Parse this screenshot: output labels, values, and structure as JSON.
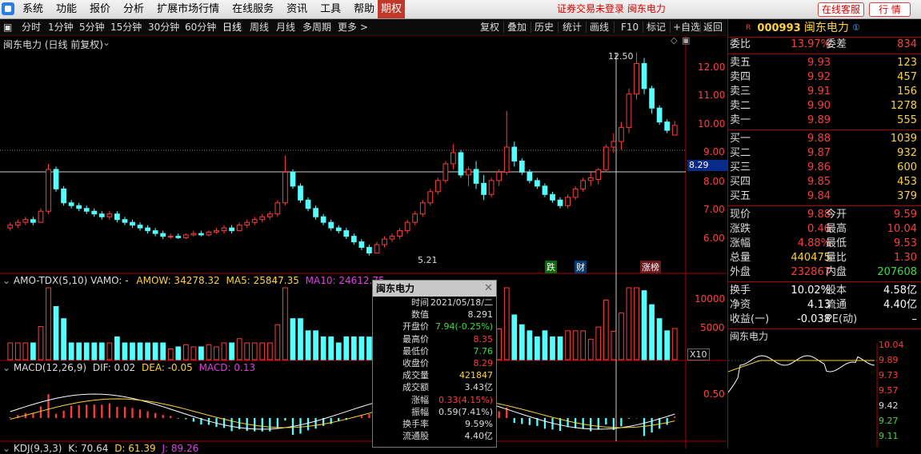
{
  "menubar": {
    "items": [
      "系统",
      "功能",
      "报价",
      "分析",
      "扩展市场行情",
      "在线服务",
      "资讯",
      "工具",
      "帮助"
    ],
    "qq_label": "期权",
    "notice": "证券交易未登录  闽东电力",
    "service_label": "在线客服",
    "quote_label": "行  情"
  },
  "toolbar": {
    "periods": [
      "分时",
      "1分钟",
      "5分钟",
      "15分钟",
      "30分钟",
      "60分钟",
      "日线",
      "周线",
      "月线",
      "多周期",
      "更多 >"
    ],
    "selected": "日线",
    "actions": [
      "复权",
      "叠加",
      "历史",
      "统计",
      "画线",
      "F10",
      "标记",
      "+自选",
      "返回"
    ]
  },
  "kline": {
    "title": "闽东电力 (日线 前复权)",
    "price_ticks": [
      "12.00",
      "11.00",
      "10.00",
      "9.00",
      "8.00",
      "7.00",
      "6.00"
    ],
    "current_price_tag": "8.29",
    "high_label": "12.50",
    "low_label": "5.21",
    "markers": [
      "跌",
      "财",
      "涨榜"
    ]
  },
  "vol": {
    "title": "AMO-TDX(5,10)  VAMO: -",
    "amow": "AMOW: 34278.32",
    "ma5": "MA5: 25847.35",
    "ma10": "MA10: 24612.75",
    "ticks": [
      "10000",
      "5000"
    ],
    "unit": "X10"
  },
  "macd": {
    "title": "MACD(12,26,9)",
    "dif": "DIF: 0.02",
    "dea": "DEA: -0.05",
    "macd": "MACD: 0.13",
    "tick": "0.50"
  },
  "kdj": {
    "title": "KDJ(9,3,3)",
    "k": "K: 70.64",
    "d": "D: 61.39",
    "j": "J: 89.26"
  },
  "info": {
    "title": "闽东电力",
    "rows": [
      [
        "时间",
        "2021/05/18/二",
        "wht"
      ],
      [
        "数值",
        "8.291",
        "wht"
      ],
      [
        "开盘价",
        "7.94(-0.25%)",
        "grn"
      ],
      [
        "最高价",
        "8.35",
        "red"
      ],
      [
        "最低价",
        "7.76",
        "grn"
      ],
      [
        "收盘价",
        "8.29",
        "red"
      ],
      [
        "成交量",
        "421847",
        "yel"
      ],
      [
        "成交额",
        "3.43亿",
        "wht"
      ],
      [
        "涨幅",
        "0.33(4.15%)",
        "red"
      ],
      [
        "振幅",
        "0.59(7.41%)",
        "wht"
      ],
      [
        "换手率",
        "9.59%",
        "wht"
      ],
      [
        "流通股",
        "4.40亿",
        "wht"
      ]
    ]
  },
  "stock": {
    "code": "000993",
    "name": "闽东电力",
    "badge": "R"
  },
  "quote": {
    "weibi": [
      "委比",
      "13.97%",
      "委差",
      "834"
    ],
    "asks": [
      [
        "卖五",
        "9.93",
        "123"
      ],
      [
        "卖四",
        "9.92",
        "457"
      ],
      [
        "卖三",
        "9.91",
        "156"
      ],
      [
        "卖二",
        "9.90",
        "1278"
      ],
      [
        "卖一",
        "9.89",
        "555"
      ]
    ],
    "bids": [
      [
        "买一",
        "9.88",
        "1039"
      ],
      [
        "买二",
        "9.87",
        "932"
      ],
      [
        "买三",
        "9.86",
        "600"
      ],
      [
        "买四",
        "9.85",
        "453"
      ],
      [
        "买五",
        "9.84",
        "379"
      ]
    ],
    "stats": [
      [
        "现价",
        "9.88",
        "今开",
        "9.59"
      ],
      [
        "涨跌",
        "0.46",
        "最高",
        "10.04"
      ],
      [
        "涨幅",
        "4.88%",
        "最低",
        "9.53"
      ],
      [
        "总量",
        "440475",
        "量比",
        "1.30"
      ],
      [
        "外盘",
        "232867",
        "内盘",
        "207608"
      ]
    ],
    "stats2": [
      [
        "换手",
        "10.02%",
        "股本",
        "4.58亿"
      ],
      [
        "净资",
        "4.13",
        "流通",
        "4.40亿"
      ],
      [
        "收益(一)",
        "-0.038",
        "PE(动)",
        "–"
      ]
    ]
  },
  "mini": {
    "title": "闽东电力",
    "ticks": [
      "10.04",
      "9.89",
      "9.73",
      "9.57",
      "9.42",
      "9.27",
      "9.11"
    ]
  },
  "chart_data": {
    "type": "candlestick",
    "title": "闽东电力 (日线 前复权)",
    "ylim": [
      5.0,
      12.8
    ],
    "candles": [
      [
        6.2,
        6.4,
        6.1,
        6.3
      ],
      [
        6.3,
        6.5,
        6.2,
        6.4
      ],
      [
        6.4,
        6.6,
        6.3,
        6.5
      ],
      [
        6.5,
        6.6,
        6.3,
        6.4
      ],
      [
        6.4,
        6.9,
        6.4,
        6.8
      ],
      [
        6.8,
        8.5,
        6.7,
        8.3
      ],
      [
        8.3,
        8.4,
        7.5,
        7.6
      ],
      [
        7.6,
        7.7,
        7.0,
        7.1
      ],
      [
        7.1,
        7.2,
        6.9,
        7.0
      ],
      [
        7.0,
        7.1,
        6.8,
        6.9
      ],
      [
        6.9,
        7.0,
        6.7,
        6.8
      ],
      [
        6.8,
        6.9,
        6.6,
        6.7
      ],
      [
        6.7,
        6.8,
        6.5,
        6.6
      ],
      [
        6.6,
        6.8,
        6.5,
        6.7
      ],
      [
        6.7,
        6.8,
        6.4,
        6.5
      ],
      [
        6.5,
        6.6,
        6.3,
        6.4
      ],
      [
        6.4,
        6.5,
        6.2,
        6.3
      ],
      [
        6.3,
        6.4,
        6.1,
        6.2
      ],
      [
        6.2,
        6.3,
        6.0,
        6.1
      ],
      [
        6.1,
        6.2,
        5.9,
        6.0
      ],
      [
        6.0,
        6.1,
        5.8,
        5.9
      ],
      [
        5.9,
        6.0,
        5.8,
        5.9
      ],
      [
        5.9,
        6.0,
        5.8,
        5.85
      ],
      [
        5.85,
        6.0,
        5.8,
        5.95
      ],
      [
        5.95,
        6.1,
        5.9,
        6.0
      ],
      [
        6.0,
        6.1,
        5.9,
        5.95
      ],
      [
        5.95,
        6.1,
        5.9,
        6.05
      ],
      [
        6.05,
        6.2,
        6.0,
        6.1
      ],
      [
        6.1,
        6.3,
        6.0,
        6.2
      ],
      [
        6.2,
        6.3,
        6.0,
        6.1
      ],
      [
        6.1,
        6.4,
        6.1,
        6.3
      ],
      [
        6.3,
        6.5,
        6.2,
        6.4
      ],
      [
        6.4,
        6.6,
        6.3,
        6.5
      ],
      [
        6.5,
        6.7,
        6.4,
        6.6
      ],
      [
        6.6,
        6.8,
        6.5,
        6.7
      ],
      [
        6.7,
        7.2,
        6.6,
        7.1
      ],
      [
        7.1,
        8.8,
        7.0,
        8.2
      ],
      [
        8.2,
        8.3,
        7.6,
        7.7
      ],
      [
        7.7,
        7.8,
        7.1,
        7.2
      ],
      [
        7.2,
        7.3,
        6.8,
        6.9
      ],
      [
        6.9,
        7.0,
        6.5,
        6.6
      ],
      [
        6.6,
        6.7,
        6.3,
        6.4
      ],
      [
        6.4,
        6.5,
        6.1,
        6.2
      ],
      [
        6.2,
        6.3,
        6.0,
        6.1
      ],
      [
        6.1,
        6.2,
        5.8,
        5.9
      ],
      [
        5.9,
        6.0,
        5.6,
        5.7
      ],
      [
        5.7,
        5.8,
        5.4,
        5.5
      ],
      [
        5.5,
        5.6,
        5.21,
        5.3
      ],
      [
        5.3,
        5.7,
        5.3,
        5.6
      ],
      [
        5.6,
        5.9,
        5.5,
        5.8
      ],
      [
        5.8,
        6.0,
        5.7,
        5.9
      ],
      [
        5.9,
        6.2,
        5.8,
        6.1
      ],
      [
        6.1,
        6.5,
        6.0,
        6.4
      ],
      [
        6.4,
        6.8,
        6.3,
        6.7
      ],
      [
        6.7,
        7.2,
        6.6,
        7.1
      ],
      [
        7.1,
        7.6,
        7.0,
        7.5
      ],
      [
        7.5,
        8.0,
        7.4,
        7.9
      ],
      [
        7.9,
        8.6,
        7.8,
        8.5
      ],
      [
        8.5,
        9.2,
        8.3,
        8.9
      ],
      [
        8.9,
        9.0,
        8.0,
        8.1
      ],
      [
        8.1,
        8.4,
        7.7,
        8.3
      ],
      [
        8.3,
        8.6,
        7.6,
        7.8
      ],
      [
        7.8,
        8.1,
        7.2,
        7.4
      ],
      [
        7.4,
        8.0,
        7.3,
        7.9
      ],
      [
        7.9,
        8.3,
        7.7,
        8.2
      ],
      [
        8.2,
        10.4,
        8.1,
        9.1
      ],
      [
        9.1,
        9.3,
        8.4,
        8.6
      ],
      [
        8.6,
        8.7,
        8.1,
        8.2
      ],
      [
        8.2,
        8.3,
        7.8,
        7.9
      ],
      [
        7.9,
        8.0,
        7.6,
        7.7
      ],
      [
        7.7,
        7.8,
        7.3,
        7.4
      ],
      [
        7.4,
        7.5,
        7.1,
        7.2
      ],
      [
        7.2,
        7.3,
        6.9,
        7.0
      ],
      [
        7.0,
        7.4,
        6.9,
        7.3
      ],
      [
        7.3,
        7.7,
        7.2,
        7.6
      ],
      [
        7.6,
        8.0,
        7.5,
        7.9
      ],
      [
        7.9,
        8.2,
        7.7,
        8.0
      ],
      [
        7.94,
        8.35,
        7.76,
        8.29
      ],
      [
        8.29,
        9.2,
        8.2,
        9.1
      ],
      [
        9.1,
        9.6,
        8.9,
        9.3
      ],
      [
        9.3,
        10.0,
        9.0,
        9.8
      ],
      [
        9.8,
        11.2,
        9.6,
        11.0
      ],
      [
        11.0,
        12.5,
        10.8,
        12.1
      ],
      [
        12.1,
        12.3,
        11.0,
        11.2
      ],
      [
        11.2,
        11.3,
        10.3,
        10.5
      ],
      [
        10.5,
        10.6,
        9.9,
        10.0
      ],
      [
        10.0,
        10.1,
        9.6,
        9.7
      ],
      [
        9.53,
        10.04,
        9.53,
        9.88
      ]
    ]
  }
}
